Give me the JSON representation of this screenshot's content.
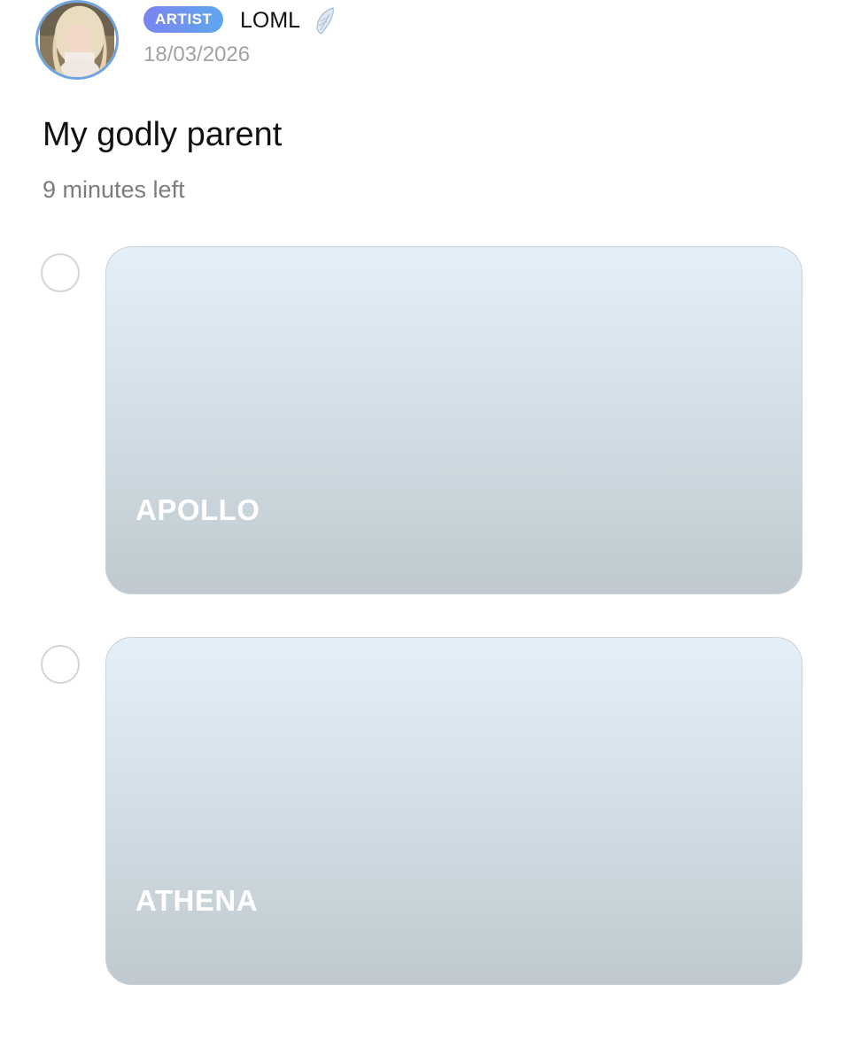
{
  "post": {
    "badge": "ARTIST",
    "username": "LOML",
    "username_icon": "wing-icon",
    "date": "18/03/2026"
  },
  "poll": {
    "question": "My godly parent",
    "time_left": "9 minutes left",
    "options": [
      {
        "label": "APOLLO"
      },
      {
        "label": "ATHENA"
      }
    ]
  },
  "colors": {
    "badge_gradient_start": "#7a84f0",
    "badge_gradient_end": "#5fa7ee",
    "avatar_ring": "#6fa4de",
    "card_gradient_top": "#e4f0f9",
    "card_gradient_bottom": "#bfc9cf",
    "secondary_text": "#7c7c7c",
    "date_text": "#a2a2a2"
  }
}
